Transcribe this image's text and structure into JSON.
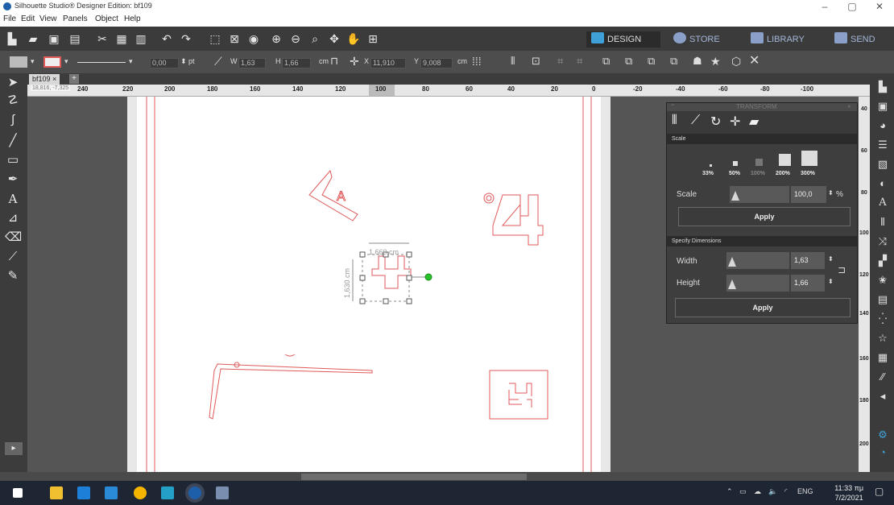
{
  "window": {
    "title": "Silhouette Studio® Designer Edition: bf109",
    "controls": [
      "–",
      "▢",
      "✕"
    ]
  },
  "menu": [
    "File",
    "Edit",
    "View",
    "Panels",
    "Object",
    "Help"
  ],
  "tabs": [
    {
      "label": "DESIGN",
      "active": true,
      "color": "#3fa0d8"
    },
    {
      "label": "STORE",
      "active": false,
      "color": "#8aa0c8"
    },
    {
      "label": "LIBRARY",
      "active": false,
      "color": "#8aa0c8"
    },
    {
      "label": "SEND",
      "active": false,
      "color": "#8aa0c8"
    }
  ],
  "line_options": {
    "width_value": "0,00",
    "unit": "pt"
  },
  "dimensions": {
    "w_label": "W",
    "w_value": "1,63",
    "h_label": "H",
    "h_value": "1,66",
    "unit": "cm",
    "x_label": "X",
    "x_value": "11,910",
    "y_label": "Y",
    "y_value": "9,008",
    "xy_unit": "cm"
  },
  "document": {
    "tab_label": "bf109",
    "close": "×",
    "add": "+"
  },
  "ruler": {
    "coord_readout": "18,816, -7,325",
    "ticks": [
      "240",
      "220",
      "200",
      "180",
      "160",
      "140",
      "120",
      "100",
      "80",
      "60",
      "40",
      "20",
      "0",
      "-20",
      "-40",
      "-60",
      "-80",
      "-100"
    ]
  },
  "canvas": {
    "selection_width_label": "1,660 cm",
    "selection_height_label": "1,630 cm",
    "line_color": "#e05a5a"
  },
  "transform_panel": {
    "title": "TRANSFORM",
    "scale_section": "Scale",
    "presets": [
      "33%",
      "50%",
      "100%",
      "200%",
      "300%"
    ],
    "scale_label": "Scale",
    "scale_value": "100,0",
    "scale_unit": "%",
    "apply": "Apply",
    "dims_section": "Specify Dimensions",
    "width_label": "Width",
    "width_value": "1,63",
    "height_label": "Height",
    "height_value": "1,66",
    "apply2": "Apply"
  },
  "vruler_ticks": [
    "40",
    "60",
    "80",
    "100",
    "120",
    "140",
    "160",
    "180",
    "200"
  ],
  "taskbar": {
    "language": "ENG",
    "time": "11:33 πμ",
    "date": "7/2/2021"
  }
}
